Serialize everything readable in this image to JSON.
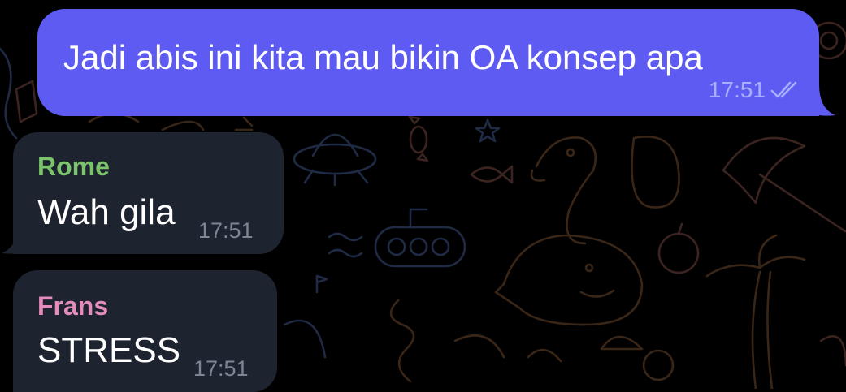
{
  "chat": {
    "messages": [
      {
        "direction": "outgoing",
        "text": "Jadi abis ini kita mau bikin OA konsep apa",
        "time": "17:51",
        "status_icon": "double-check-icon"
      },
      {
        "direction": "incoming",
        "sender": "Rome",
        "sender_color": "#7cc46b",
        "text": "Wah gila",
        "time": "17:51"
      },
      {
        "direction": "incoming",
        "sender": "Frans",
        "sender_color": "#e48cbc",
        "text": "STRESS",
        "time": "17:51"
      }
    ]
  },
  "theme": {
    "background": "#000000",
    "outgoing_bubble": "#5e5bf2",
    "incoming_bubble": "#1e2330"
  }
}
